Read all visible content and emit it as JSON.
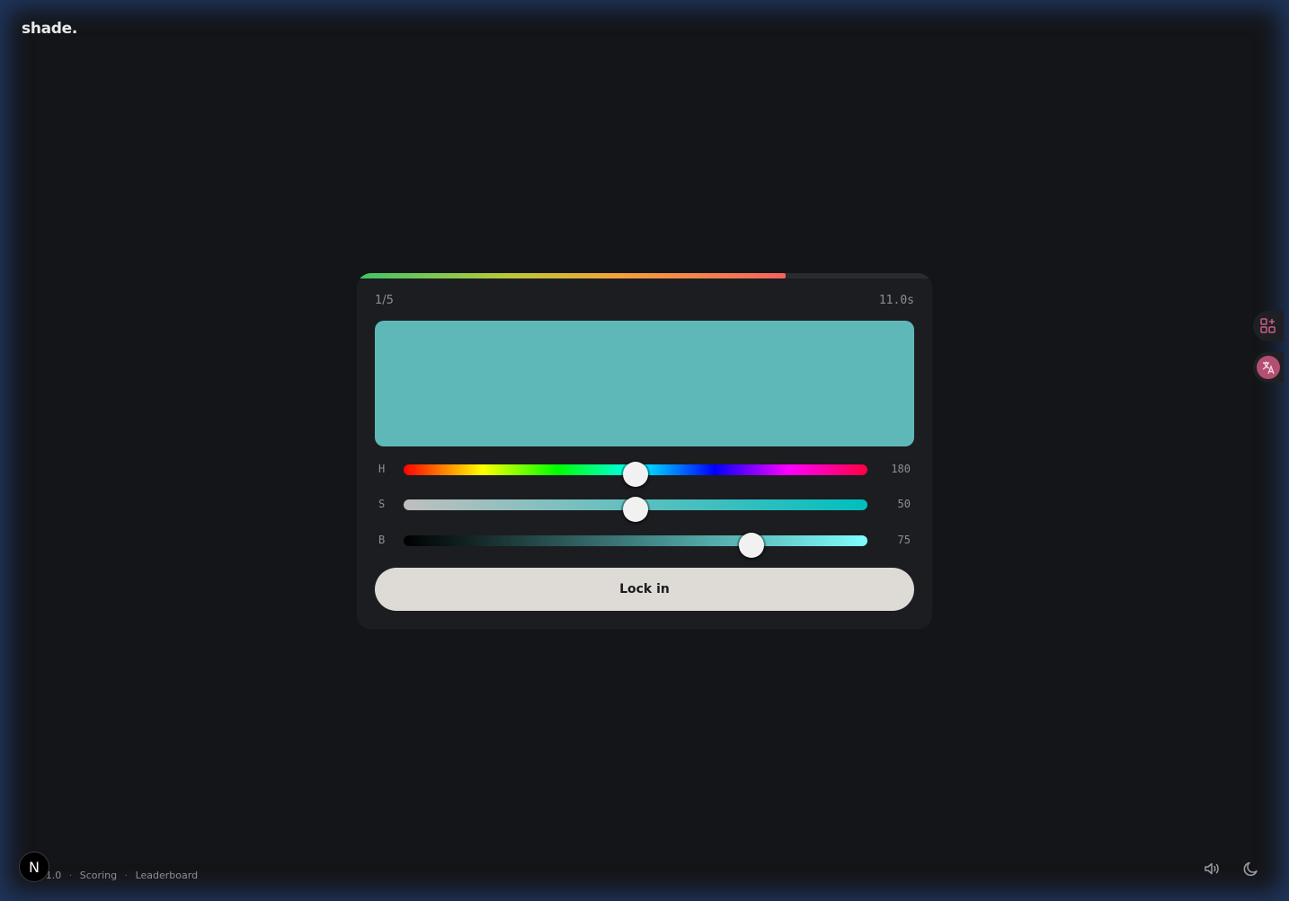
{
  "app": {
    "logo": "shade."
  },
  "game": {
    "round": "1/5",
    "timer": "11.0s",
    "progress_fraction": 0.745,
    "swatch_color": "#5fb8b8"
  },
  "sliders": [
    {
      "label": "H",
      "value": "180",
      "min": 0,
      "max": 360,
      "current": 180
    },
    {
      "label": "S",
      "value": "50",
      "min": 0,
      "max": 100,
      "current": 50
    },
    {
      "label": "B",
      "value": "75",
      "min": 0,
      "max": 100,
      "current": 75
    }
  ],
  "actions": {
    "lock_label": "Lock in"
  },
  "footer": {
    "avatar_letter": "N",
    "version": "e v1.0",
    "scoring": "Scoring",
    "leaderboard": "Leaderboard",
    "separator": "·"
  },
  "icons": {
    "apps": "apps-sparkle-icon",
    "translate": "translate-icon",
    "sound": "volume-icon",
    "theme": "moon-icon"
  },
  "colors": {
    "accent_side": "#b34f70",
    "button_bg": "#dedbd6"
  }
}
